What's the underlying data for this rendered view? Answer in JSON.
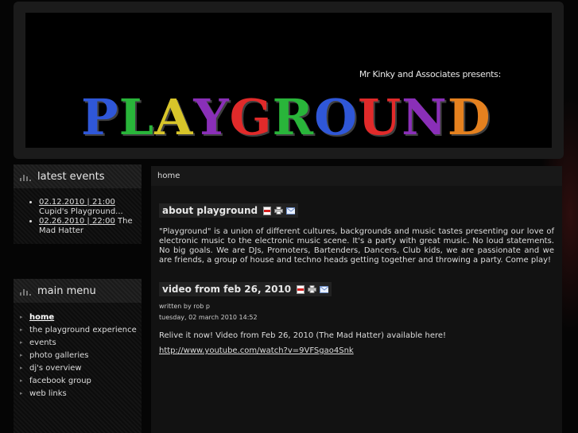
{
  "header": {
    "presenter": "Mr Kinky and Associates presents:",
    "logo_text": "PLAYGROUND",
    "logo_letters": [
      {
        "ch": "P",
        "color": "#2f57d8"
      },
      {
        "ch": "L",
        "color": "#29b53a"
      },
      {
        "ch": "A",
        "color": "#d8c52a"
      },
      {
        "ch": "Y",
        "color": "#8a2fb8"
      },
      {
        "ch": "G",
        "color": "#e12a2a"
      },
      {
        "ch": "R",
        "color": "#29b53a"
      },
      {
        "ch": "O",
        "color": "#2f57d8"
      },
      {
        "ch": "U",
        "color": "#e12a2a"
      },
      {
        "ch": "N",
        "color": "#8a2fb8"
      },
      {
        "ch": "D",
        "color": "#e5811f"
      }
    ]
  },
  "latest_events": {
    "title": "latest events",
    "items": [
      {
        "date": "02.12.2010 | 21:00",
        "text": " Cupid's Playground..."
      },
      {
        "date": "02.26.2010 | 22:00",
        "text": " The Mad Hatter"
      }
    ]
  },
  "main_menu": {
    "title": "main menu",
    "items": [
      "home",
      "the playground experience",
      "events",
      "photo galleries",
      "dj's overview",
      "facebook group",
      "web links"
    ]
  },
  "content": {
    "breadcrumb": "home",
    "about_title": "about playground",
    "about_text": "\"Playground\" is a union of different cultures, backgrounds and music tastes presenting our love of electronic music to the electronic music scene. It's a party with great music. No loud statements. No big goals. We are DJs, Promoters, Bartenders, Dancers, Club kids, we are passionate and we are friends, a group of house and techno heads getting together and throwing a party. Come play!",
    "video_title": "video from feb 26, 2010",
    "author": "written by rob p",
    "date": "tuesday, 02 march 2010 14:52",
    "video_text": "Relive it now! Video from Feb 26, 2010 (The Mad Hatter) available here!",
    "video_link": "http://www.youtube.com/watch?v=9VFSgao4Snk"
  }
}
